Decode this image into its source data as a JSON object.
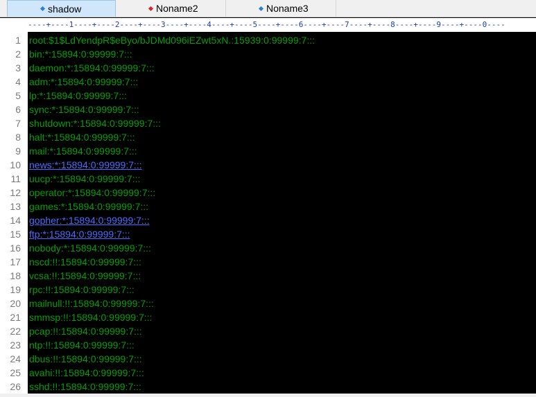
{
  "tabs": [
    {
      "label": "shadow",
      "active": true,
      "dot_color": "#2b7fd6"
    },
    {
      "label": "Noname2",
      "active": false,
      "dot_color": "#d9242a"
    },
    {
      "label": "Noname3",
      "active": false,
      "dot_color": "#2b7fd6"
    }
  ],
  "ruler": "----+----1----+----2----+----3----+----4----+----5----+----6----+----7----+----8----+----9----+----0----",
  "lines": [
    {
      "num": "1",
      "text": "root:$1$LdYendpR$eByo/bJDMd096iEZwt5xN.:15939:0:99999:7:::",
      "link": false
    },
    {
      "num": "2",
      "text": "bin:*:15894:0:99999:7:::",
      "link": false
    },
    {
      "num": "3",
      "text": "daemon:*:15894:0:99999:7:::",
      "link": false
    },
    {
      "num": "4",
      "text": "adm:*:15894:0:99999:7:::",
      "link": false
    },
    {
      "num": "5",
      "text": "lp:*:15894:0:99999:7:::",
      "link": false
    },
    {
      "num": "6",
      "text": "sync:*:15894:0:99999:7:::",
      "link": false
    },
    {
      "num": "7",
      "text": "shutdown:*:15894:0:99999:7:::",
      "link": false
    },
    {
      "num": "8",
      "text": "halt:*:15894:0:99999:7:::",
      "link": false
    },
    {
      "num": "9",
      "text": "mail:*:15894:0:99999:7:::",
      "link": false
    },
    {
      "num": "10",
      "text": "news:*:15894:0:99999:7:::",
      "link": true
    },
    {
      "num": "11",
      "text": "uucp:*:15894:0:99999:7:::",
      "link": false
    },
    {
      "num": "12",
      "text": "operator:*:15894:0:99999:7:::",
      "link": false
    },
    {
      "num": "13",
      "text": "games:*:15894:0:99999:7:::",
      "link": false
    },
    {
      "num": "14",
      "text": "gopher:*:15894:0:99999:7:::",
      "link": true
    },
    {
      "num": "15",
      "text": "ftp:*:15894:0:99999:7:::",
      "link": true
    },
    {
      "num": "16",
      "text": "nobody:*:15894:0:99999:7:::",
      "link": false
    },
    {
      "num": "17",
      "text": "nscd:!!:15894:0:99999:7:::",
      "link": false
    },
    {
      "num": "18",
      "text": "vcsa:!!:15894:0:99999:7:::",
      "link": false
    },
    {
      "num": "19",
      "text": "rpc:!!:15894:0:99999:7:::",
      "link": false
    },
    {
      "num": "20",
      "text": "mailnull:!!:15894:0:99999:7:::",
      "link": false
    },
    {
      "num": "21",
      "text": "smmsp:!!:15894:0:99999:7:::",
      "link": false
    },
    {
      "num": "22",
      "text": "pcap:!!:15894:0:99999:7:::",
      "link": false
    },
    {
      "num": "23",
      "text": "ntp:!!:15894:0:99999:7:::",
      "link": false
    },
    {
      "num": "24",
      "text": "dbus:!!:15894:0:99999:7:::",
      "link": false
    },
    {
      "num": "25",
      "text": "avahi:!!:15894:0:99999:7:::",
      "link": false
    },
    {
      "num": "26",
      "text": "sshd:!!:15894:0:99999:7:::",
      "link": false
    }
  ]
}
